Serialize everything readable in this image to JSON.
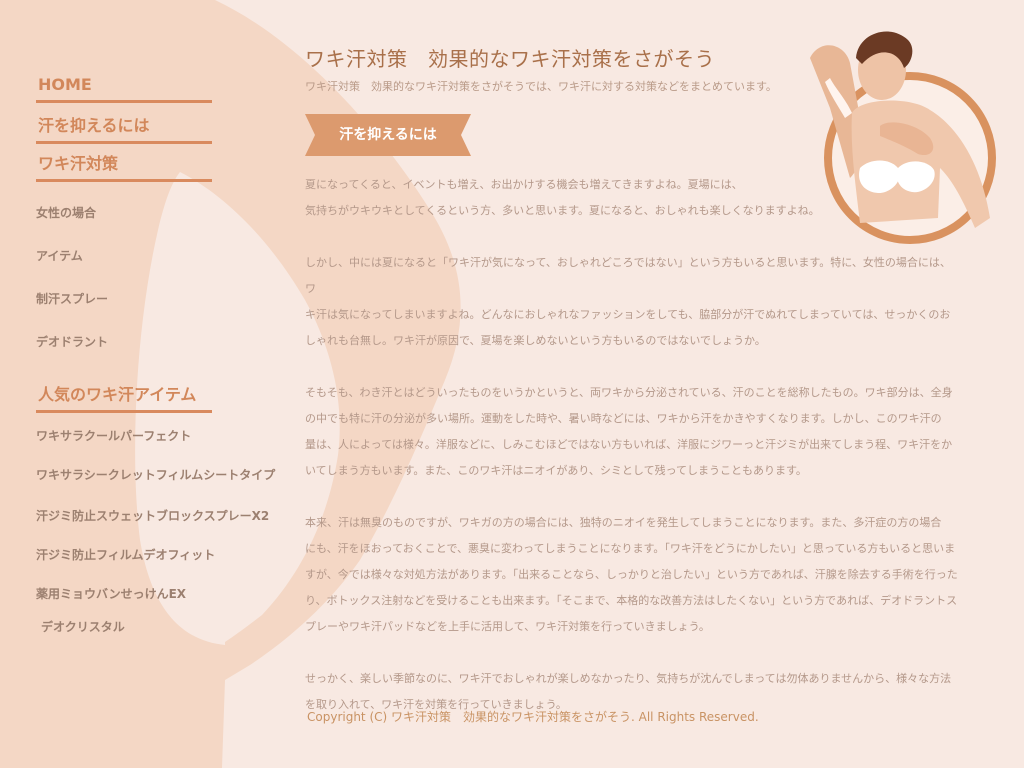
{
  "colors": {
    "background": "#f8e9e2",
    "shape": "#f4d7c5",
    "accent": "#d98a5e",
    "title": "#a9704a",
    "body_text": "#b4988a",
    "footer_text": "#c99364"
  },
  "header": {
    "title": "ワキ汗対策　効果的なワキ汗対策をさがそう",
    "subtitle": "ワキ汗対策　効果的なワキ汗対策をさがそうでは、ワキ汗に対する対策などをまとめています。"
  },
  "sidebar": {
    "main_links": [
      {
        "label": "HOME"
      },
      {
        "label": "汗を抑えるには"
      },
      {
        "label": "ワキ汗対策"
      }
    ],
    "sub_links": [
      {
        "label": "女性の場合"
      },
      {
        "label": "アイテム"
      },
      {
        "label": "制汗スプレー"
      },
      {
        "label": "デオドラント"
      }
    ],
    "items_heading": "人気のワキ汗アイテム",
    "item_links": [
      {
        "label": "ワキサラクールパーフェクト"
      },
      {
        "label": "ワキサラシークレットフィルムシートタイプ"
      },
      {
        "label": "汗ジミ防止スウェットブロックスプレーX2"
      },
      {
        "label": "汗ジミ防止フィルムデオフィット"
      },
      {
        "label": "薬用ミョウバンせっけんEX"
      },
      {
        "label": "デオクリスタル"
      }
    ]
  },
  "main": {
    "section_heading": "汗を抑えるには",
    "paragraphs": [
      [
        "夏になってくると、イベントも増え、お出かけする機会も増えてきますよね。夏場には、",
        "気持ちがウキウキとしてくるという方、多いと思います。夏になると、おしゃれも楽しくなりますよね。"
      ],
      [
        "しかし、中には夏になると「ワキ汗が気になって、おしゃれどころではない」という方もいると思います。特に、女性の場合には、ワ",
        "キ汗は気になってしまいますよね。どんなにおしゃれなファッションをしても、脇部分が汗でぬれてしまっていては、せっかくのお",
        "しゃれも台無し。ワキ汗が原因で、夏場を楽しめないという方もいるのではないでしょうか。"
      ],
      [
        "そもそも、わき汗とはどういったものをいうかというと、両ワキから分泌されている、汗のことを総称したもの。ワキ部分は、全身",
        "の中でも特に汗の分泌が多い場所。運動をした時や、暑い時などには、ワキから汗をかきやすくなります。しかし、このワキ汗の",
        "量は、人によっては様々。洋服などに、しみこむほどではない方もいれば、洋服にジワーっと汗ジミが出来てしまう程、ワキ汗をか",
        "いてしまう方もいます。また、このワキ汗はニオイがあり、シミとして残ってしまうこともあります。"
      ],
      [
        "本来、汗は無臭のものですが、ワキガの方の場合には、独特のニオイを発生してしまうことになります。また、多汗症の方の場合",
        "にも、汗をほおっておくことで、悪臭に変わってしまうことになります。「ワキ汗をどうにかしたい」と思っている方もいると思いま",
        "すが、今では様々な対処方法があります。「出来ることなら、しっかりと治したい」という方であれば、汗腺を除去する手術を行った",
        "り、ボトックス注射などを受けることも出来ます。「そこまで、本格的な改善方法はしたくない」という方であれば、デオドラントス",
        "プレーやワキ汗パッドなどを上手に活用して、ワキ汗対策を行っていきましょう。"
      ],
      [
        "せっかく、楽しい季節なのに、ワキ汗でおしゃれが楽しめなかったり、気持ちが沈んでしまっては勿体ありませんから、様々な方法",
        "を取り入れて、ワキ汗を対策を行っていきましょう。"
      ]
    ]
  },
  "footer": {
    "copyright": "Copyright (C) ワキ汗対策　効果的なワキ汗対策をさがそう.  All Rights Reserved."
  }
}
